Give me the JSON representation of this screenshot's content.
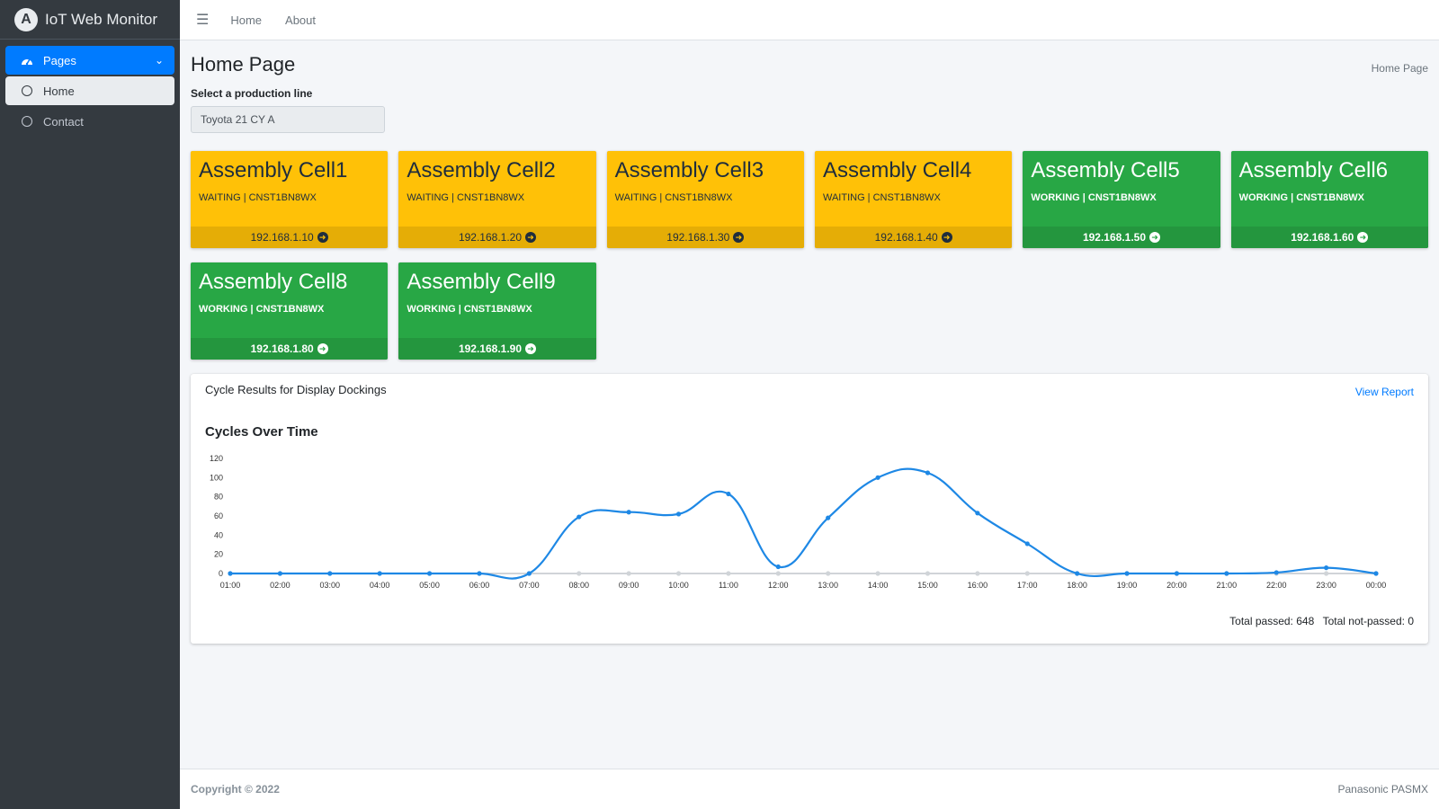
{
  "app": {
    "title": "IoT Web Monitor",
    "logo_letter": "A"
  },
  "sidebar": {
    "section": {
      "label": "Pages",
      "icon": "dashboard-icon"
    },
    "items": [
      {
        "label": "Home",
        "icon": "circle-icon"
      },
      {
        "label": "Contact",
        "icon": "circle-icon"
      }
    ]
  },
  "topnav": {
    "links": [
      "Home",
      "About"
    ]
  },
  "page": {
    "title": "Home Page",
    "breadcrumb": "Home Page"
  },
  "selector": {
    "label": "Select a production line",
    "value": "Toyota 21 CY A"
  },
  "colors": {
    "waiting": "#ffc107",
    "working": "#28a745",
    "accent": "#007bff",
    "sidebar": "#343a40"
  },
  "cells": [
    {
      "name": "Assembly Cell1",
      "status": "WAITING | CNST1BN8WX",
      "ip": "192.168.1.10",
      "state": "waiting"
    },
    {
      "name": "Assembly Cell2",
      "status": "WAITING | CNST1BN8WX",
      "ip": "192.168.1.20",
      "state": "waiting"
    },
    {
      "name": "Assembly Cell3",
      "status": "WAITING | CNST1BN8WX",
      "ip": "192.168.1.30",
      "state": "waiting"
    },
    {
      "name": "Assembly Cell4",
      "status": "WAITING | CNST1BN8WX",
      "ip": "192.168.1.40",
      "state": "waiting"
    },
    {
      "name": "Assembly Cell5",
      "status": "WORKING | CNST1BN8WX",
      "ip": "192.168.1.50",
      "state": "working"
    },
    {
      "name": "Assembly Cell6",
      "status": "WORKING | CNST1BN8WX",
      "ip": "192.168.1.60",
      "state": "working"
    },
    {
      "name": "Assembly Cell8",
      "status": "WORKING | CNST1BN8WX",
      "ip": "192.168.1.80",
      "state": "working"
    },
    {
      "name": "Assembly Cell9",
      "status": "WORKING | CNST1BN8WX",
      "ip": "192.168.1.90",
      "state": "working"
    }
  ],
  "report_card": {
    "title": "Cycle Results for Display Dockings",
    "link": "View Report",
    "totals": {
      "passed": "Total passed: 648",
      "not_passed": "Total not-passed: 0"
    }
  },
  "chart_data": {
    "type": "line",
    "title": "Cycles Over Time",
    "xlabel": "",
    "ylabel": "",
    "ylim": [
      0,
      120
    ],
    "yticks": [
      0,
      20,
      40,
      60,
      80,
      100,
      120
    ],
    "categories": [
      "01:00",
      "02:00",
      "03:00",
      "04:00",
      "05:00",
      "06:00",
      "07:00",
      "08:00",
      "09:00",
      "10:00",
      "11:00",
      "12:00",
      "13:00",
      "14:00",
      "15:00",
      "16:00",
      "17:00",
      "18:00",
      "19:00",
      "20:00",
      "21:00",
      "22:00",
      "23:00",
      "00:00"
    ],
    "series": [
      {
        "color": "#1e88e5",
        "values": [
          0,
          0,
          0,
          0,
          0,
          0,
          0,
          59,
          64,
          62,
          83,
          7,
          58,
          100,
          105,
          63,
          31,
          0,
          0,
          0,
          0,
          1,
          6,
          0
        ]
      },
      {
        "color": "#d0d4d8",
        "values": [
          0,
          0,
          0,
          0,
          0,
          0,
          0,
          0,
          0,
          0,
          0,
          0,
          0,
          0,
          0,
          0,
          0,
          0,
          0,
          0,
          0,
          0,
          0,
          0
        ]
      }
    ],
    "grid": false,
    "legend": "none"
  },
  "footer": {
    "copyright": "Copyright © 2022",
    "brand": "Panasonic PASMX"
  }
}
